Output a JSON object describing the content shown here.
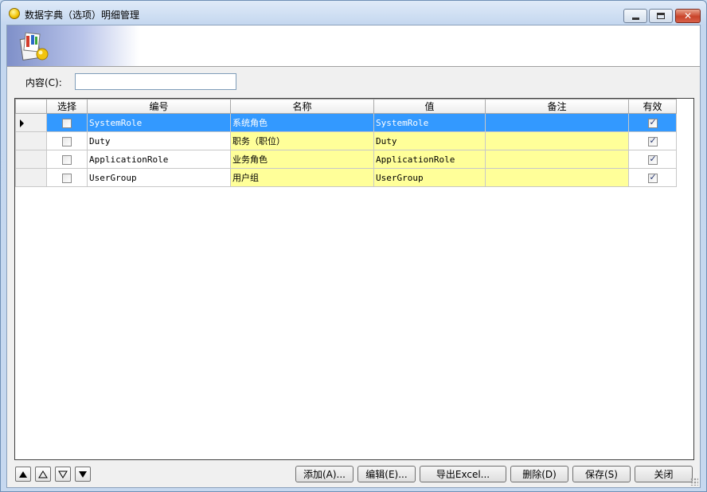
{
  "window": {
    "title": "数据字典（选项）明细管理",
    "close_glyph": "✕"
  },
  "filter": {
    "label": "内容(C):",
    "value": ""
  },
  "grid": {
    "columns": [
      "选择",
      "编号",
      "名称",
      "值",
      "备注",
      "有效"
    ],
    "rows": [
      {
        "selected": false,
        "code": "SystemRole",
        "name": "系统角色",
        "value": "SystemRole",
        "remark": "",
        "valid": true
      },
      {
        "selected": false,
        "code": "Duty",
        "name": "职务（职位）",
        "value": "Duty",
        "remark": "",
        "valid": true
      },
      {
        "selected": false,
        "code": "ApplicationRole",
        "name": "业务角色",
        "value": "ApplicationRole",
        "remark": "",
        "valid": true
      },
      {
        "selected": false,
        "code": "UserGroup",
        "name": "用户组",
        "value": "UserGroup",
        "remark": "",
        "valid": true
      }
    ]
  },
  "buttons": {
    "add": "添加(A)...",
    "edit": "编辑(E)...",
    "export": "导出Excel...",
    "delete": "删除(D)",
    "save": "保存(S)",
    "close": "关闭"
  },
  "colors": {
    "selection": "#3399ff",
    "editable_cell": "#ffff99"
  }
}
